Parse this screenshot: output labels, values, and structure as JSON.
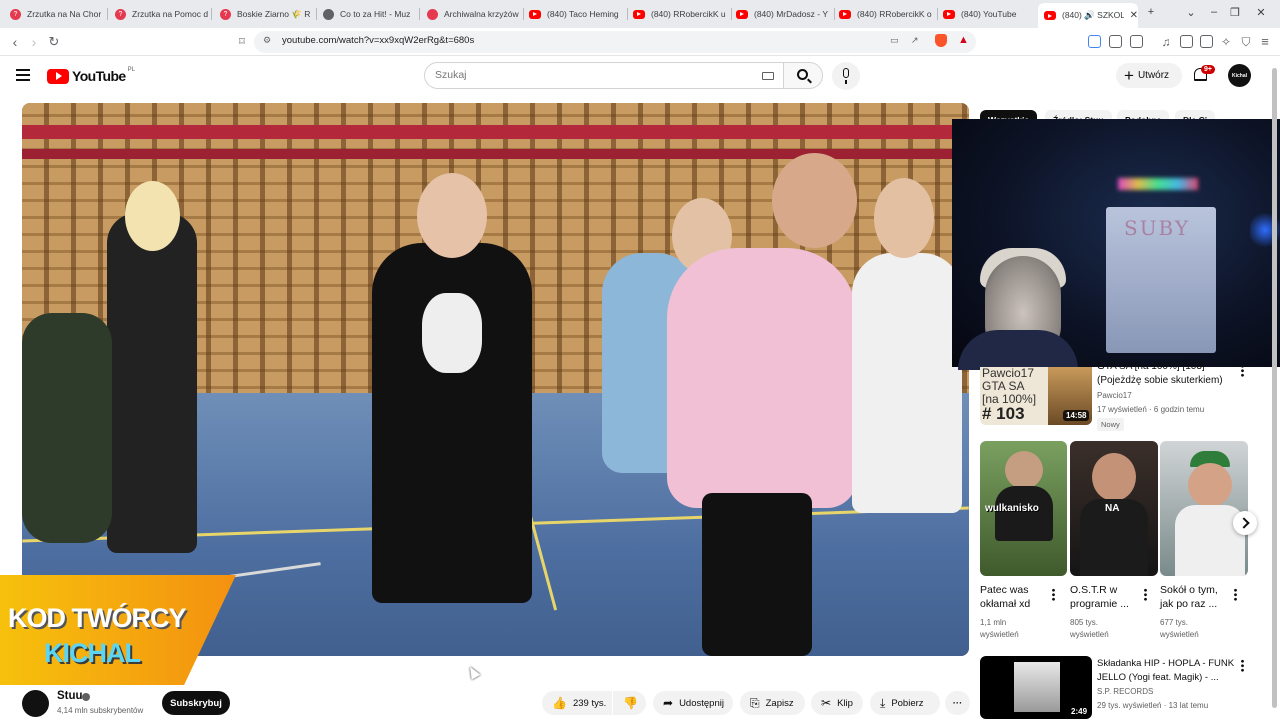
{
  "browser": {
    "tabs": [
      {
        "label": "Zrzutka na Na Chor",
        "icon": "zrzutka-icon",
        "color": "#e53950"
      },
      {
        "label": "Zrzutka na Pomoc d",
        "icon": "zrzutka-icon",
        "color": "#e53950"
      },
      {
        "label": "Boskie Ziarno 🌾 R",
        "icon": "zrzutka-icon",
        "color": "#e53950"
      },
      {
        "label": "Co to za Hit! - Muz",
        "icon": "hit-icon",
        "color": "#5f6368"
      },
      {
        "label": "Archiwalna krzyżów",
        "icon": "puzzle-icon",
        "color": "#e53950"
      },
      {
        "label": "(840) Taco Heming",
        "icon": "youtube-icon",
        "color": "#ff0000"
      },
      {
        "label": "(840) RRobercikK u",
        "icon": "youtube-icon",
        "color": "#ff0000"
      },
      {
        "label": "(840) MrDadosz - Y",
        "icon": "youtube-icon",
        "color": "#ff0000"
      },
      {
        "label": "(840) RRobercikK o",
        "icon": "youtube-icon",
        "color": "#ff0000"
      },
      {
        "label": "(840) YouTube",
        "icon": "youtube-icon",
        "color": "#ff0000"
      },
      {
        "label": "(840) 🔊 SZKOL",
        "icon": "youtube-icon",
        "color": "#ff0000"
      }
    ],
    "new_tab": "+",
    "url": "youtube.com/watch?v=xx9xqW2erRg&t=680s"
  },
  "header": {
    "logo_text": "YouTube",
    "logo_suffix": "PL",
    "search_placeholder": "Szukaj",
    "create_label": "Utwórz",
    "notifications_count": "9+",
    "avatar_text": "Kichal"
  },
  "video": {
    "creator_code_line1": "KOD TWÓRCY",
    "creator_code_line2": "KICHAL"
  },
  "channel": {
    "name": "Stuu",
    "subscribers": "4,14 mln subskrybentów",
    "subscribe_label": "Subskrybuj"
  },
  "actions": {
    "likes": "239 tys.",
    "share": "Udostępnij",
    "save": "Zapisz",
    "clip": "Klip",
    "download": "Pobierz"
  },
  "sidebar": {
    "chips": [
      "Wszystkie",
      "Źródło: Stuu",
      "Podobne",
      "Dla Ci"
    ],
    "webcam_board_text": "SUBY",
    "videos": [
      {
        "thumb_text": [
          "Pawcio17",
          "GTA SA",
          "[na 100%]",
          "# 103"
        ],
        "title": [
          "GTA SA [na 100%] [103]",
          "(Pojeżdżę sobie skuterkiem)"
        ],
        "channel": "Pawcio17",
        "meta": "17 wyświetleń · 6 godzin temu",
        "badge": "Nowy",
        "duration": "14:58"
      },
      {
        "title": [
          "Składanka HIP - HOPLA - FUNK",
          "JELLO (Yogi feat. Magik) - ..."
        ],
        "channel": "S.P. RECORDS",
        "meta": "29 tys. wyświetleń · 13 lat temu",
        "duration": "2:49"
      }
    ],
    "shorts": [
      {
        "title": [
          "Patec was",
          "okłamał xd"
        ],
        "views": [
          "1,1 mln",
          "wyświetleń"
        ],
        "overlay": "wulkanisko"
      },
      {
        "title": [
          "O.S.T.R w",
          "programie ..."
        ],
        "views": [
          "805 tys.",
          "wyświetleń"
        ],
        "overlay": "NA"
      },
      {
        "title": [
          "Sokół o tym,",
          "jak po raz ..."
        ],
        "views": [
          "677 tys.",
          "wyświetleń"
        ],
        "overlay": ""
      }
    ]
  }
}
